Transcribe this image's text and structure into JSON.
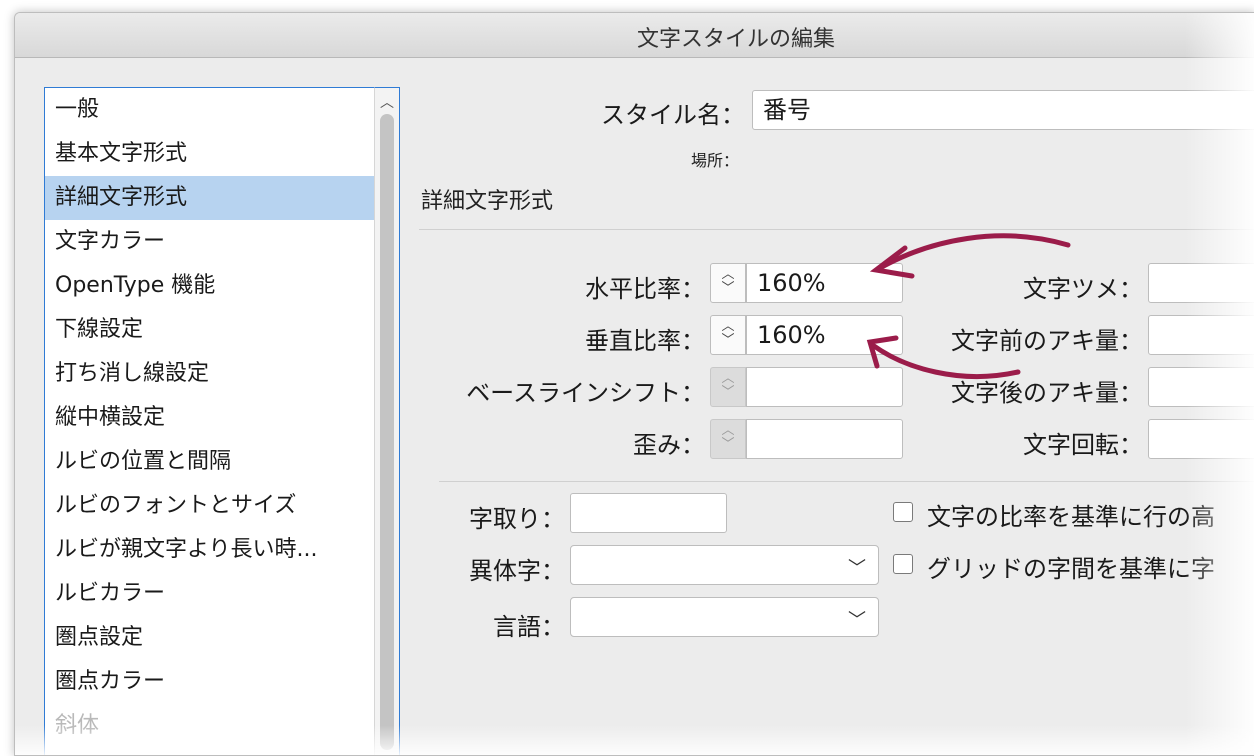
{
  "window": {
    "title": "文字スタイルの編集"
  },
  "sidebar": {
    "items": [
      {
        "label": "一般"
      },
      {
        "label": "基本文字形式"
      },
      {
        "label": "詳細文字形式",
        "selected": true
      },
      {
        "label": "文字カラー"
      },
      {
        "label": "OpenType 機能"
      },
      {
        "label": "下線設定"
      },
      {
        "label": "打ち消し線設定"
      },
      {
        "label": "縦中横設定"
      },
      {
        "label": "ルビの位置と間隔"
      },
      {
        "label": "ルビのフォントとサイズ"
      },
      {
        "label": "ルビが親文字より長い時..."
      },
      {
        "label": "ルビカラー"
      },
      {
        "label": "圏点設定"
      },
      {
        "label": "圏点カラー"
      },
      {
        "label": "斜体"
      }
    ]
  },
  "main": {
    "style_name_label": "スタイル名：",
    "style_name_value": "番号",
    "location_label": "場所：",
    "section_title": "詳細文字形式",
    "horizontal_scale_label": "水平比率：",
    "horizontal_scale_value": "160%",
    "vertical_scale_label": "垂直比率：",
    "vertical_scale_value": "160%",
    "baseline_shift_label": "ベースラインシフト：",
    "baseline_shift_value": "",
    "skew_label": "歪み：",
    "skew_value": "",
    "tsume_label": "文字ツメ：",
    "aki_before_label": "文字前のアキ量：",
    "aki_after_label": "文字後のアキ量：",
    "rotation_label": "文字回転：",
    "jidori_label": "字取り：",
    "jidori_value": "",
    "itaiji_label": "異体字：",
    "itaiji_value": "",
    "language_label": "言語：",
    "language_value": "",
    "checkbox1_label": "文字の比率を基準に行の高",
    "checkbox2_label": "グリッドの字間を基準に字"
  },
  "colors": {
    "accent": "#2f7bd5",
    "selection": "#b7d3f0",
    "annotation_arrow": "#9b1c4a"
  },
  "icons": {
    "stepper": "stepper-up-down-icon",
    "select": "chevron-down-icon",
    "scroll": "chevron-up-icon"
  }
}
